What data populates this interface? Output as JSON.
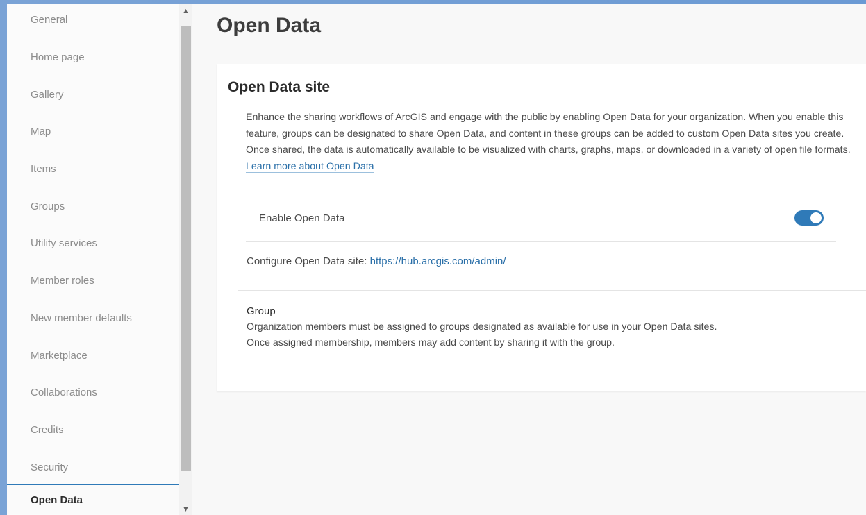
{
  "sidebar": {
    "items": [
      {
        "label": "General"
      },
      {
        "label": "Home page"
      },
      {
        "label": "Gallery"
      },
      {
        "label": "Map"
      },
      {
        "label": "Items"
      },
      {
        "label": "Groups"
      },
      {
        "label": "Utility services"
      },
      {
        "label": "Member roles"
      },
      {
        "label": "New member defaults"
      },
      {
        "label": "Marketplace"
      },
      {
        "label": "Collaborations"
      },
      {
        "label": "Credits"
      },
      {
        "label": "Security"
      },
      {
        "label": "Open Data"
      }
    ],
    "active_label": "Open Data",
    "scroll_up_icon": "caret-up-icon",
    "scroll_down_icon": "caret-down-icon"
  },
  "main": {
    "title": "Open Data",
    "section": {
      "title": "Open Data site",
      "description": "Enhance the sharing workflows of ArcGIS and engage with the public by enabling Open Data for your organization. When you enable this feature, groups can be designated to share Open Data, and content in these groups can be added to custom Open Data sites you create. Once shared, the data is automatically available to be visualized with charts, graphs, maps, or downloaded in a variety of open file formats.",
      "learn_more_link": "Learn more about Open Data",
      "enable_label": "Enable Open Data",
      "enable_state": true,
      "configure_label": "Configure Open Data site:",
      "configure_link": "https://hub.arcgis.com/admin/",
      "group_title": "Group",
      "group_desc_line1": "Organization members must be assigned to groups designated as available for use in your Open Data sites.",
      "group_desc_line2": "Once assigned membership, members may add content by sharing it with the group."
    }
  },
  "colors": {
    "accent": "#2f7ab8",
    "link": "#2a6fa8",
    "background_frame": "#7aa3d6"
  }
}
